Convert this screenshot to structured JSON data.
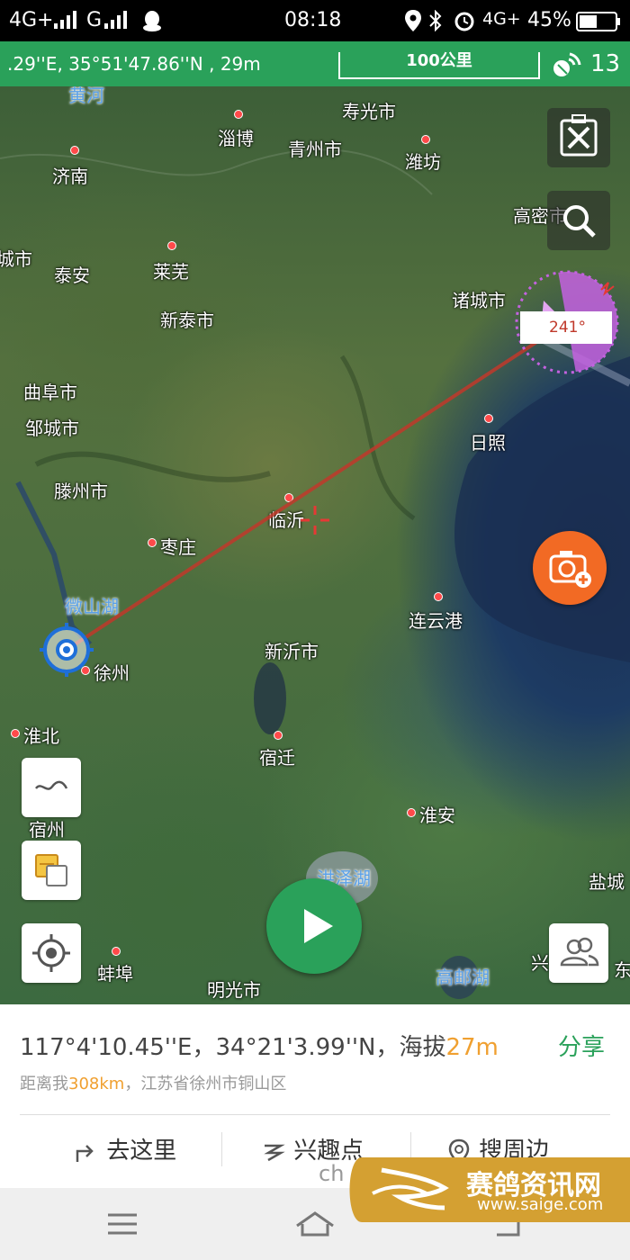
{
  "status_bar": {
    "network_left": "4G+",
    "network_mid": "G",
    "time": "08:18",
    "network_right": "4G+",
    "battery": "45%"
  },
  "top_bar": {
    "coordinate_display": ".29''E, 35°51'47.86''N , 29m",
    "scale_label": "100公里",
    "satellite_count": "13"
  },
  "map": {
    "bearing_label": "241°",
    "cities": [
      {
        "name": "黄河",
        "water": true
      },
      {
        "name": "寿光市"
      },
      {
        "name": "淄博"
      },
      {
        "name": "青州市"
      },
      {
        "name": "济南"
      },
      {
        "name": "潍坊"
      },
      {
        "name": "高密市"
      },
      {
        "name": "城市"
      },
      {
        "name": "泰安"
      },
      {
        "name": "莱芜"
      },
      {
        "name": "诸城市"
      },
      {
        "name": "新泰市"
      },
      {
        "name": "曲阜市"
      },
      {
        "name": "邹城市"
      },
      {
        "name": "日照"
      },
      {
        "name": "滕州市"
      },
      {
        "name": "临沂"
      },
      {
        "name": "枣庄"
      },
      {
        "name": "微山湖",
        "water": true
      },
      {
        "name": "连云港"
      },
      {
        "name": "徐州"
      },
      {
        "name": "新沂市"
      },
      {
        "name": "淮北"
      },
      {
        "name": "宿迁"
      },
      {
        "name": "宿州"
      },
      {
        "name": "淮安"
      },
      {
        "name": "洪泽湖",
        "water": true
      },
      {
        "name": "盐城"
      },
      {
        "name": "蚌埠"
      },
      {
        "name": "明光市"
      },
      {
        "name": "高邮湖",
        "water": true
      },
      {
        "name": "兴"
      },
      {
        "name": "东"
      }
    ],
    "route_color": "#c0392b",
    "target_color": "#c462e0",
    "locate_color": "#1e6fd9"
  },
  "info_panel": {
    "longitude": "117°4'10.45''E，",
    "latitude": "34°21'3.99''N，",
    "altitude_label": "海拔",
    "altitude_value": "27m",
    "share_label": "分享",
    "distance_prefix": "距离我",
    "distance_value": "308km",
    "location": "，江苏省徐州市铜山区",
    "actions": [
      {
        "label": "去这里",
        "icon": "turn-arrow-icon"
      },
      {
        "label": "兴趣点",
        "icon": "poi-icon"
      },
      {
        "label": "搜周边",
        "icon": "location-pin-icon"
      }
    ]
  },
  "watermark": {
    "title": "赛鸽资讯网",
    "url": "www.saige.com",
    "fragment": "ch"
  },
  "colors": {
    "brand_green": "#2aa15a",
    "accent_orange": "#f26a24",
    "highlight_orange": "#f0a030"
  }
}
